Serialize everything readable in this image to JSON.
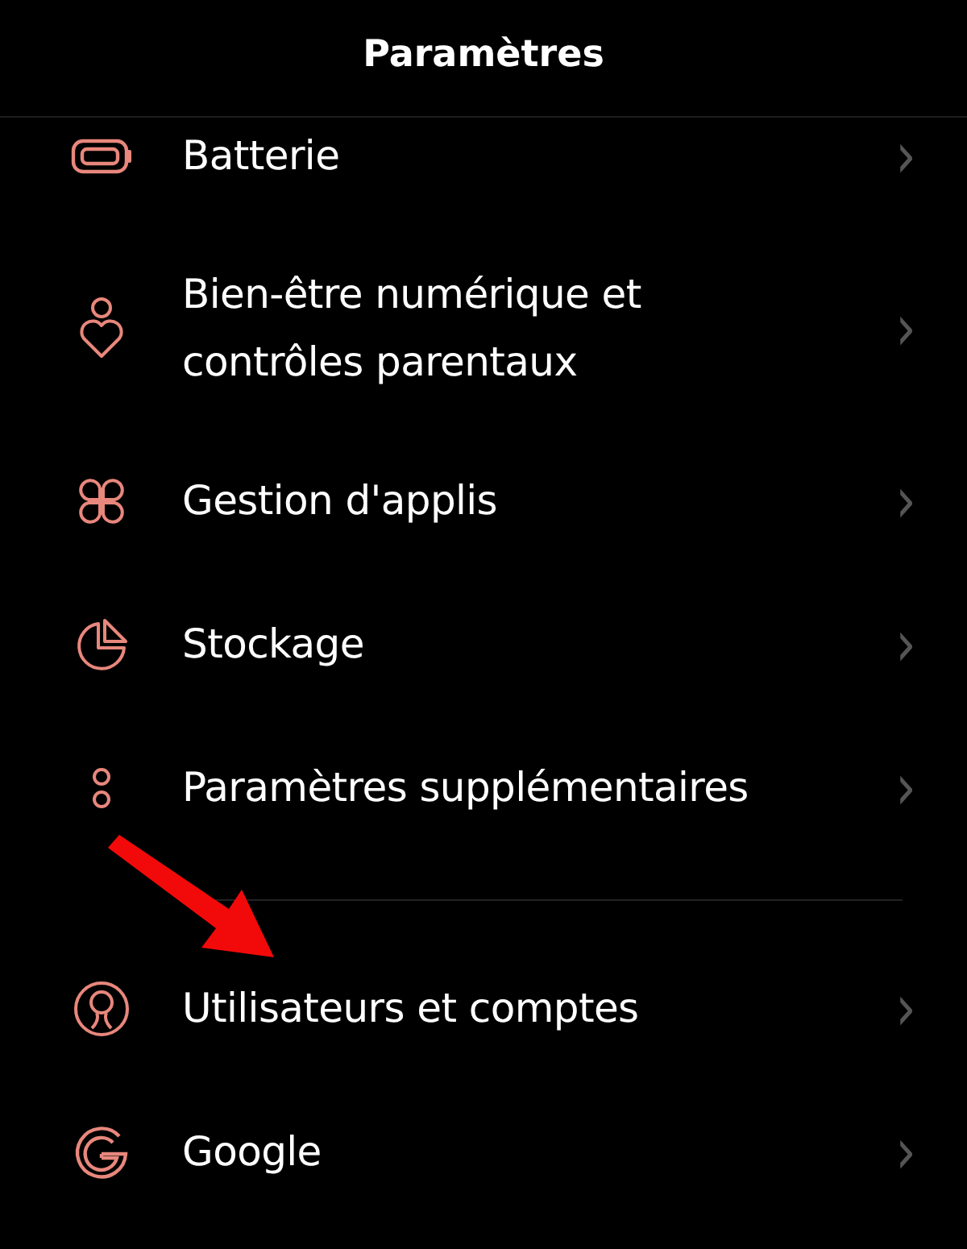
{
  "header": {
    "title": "Paramètres"
  },
  "sections": [
    {
      "items": [
        {
          "kind": "battery",
          "label": "Batterie",
          "chevron": "›"
        },
        {
          "kind": "wellbeing",
          "label": "Bien-être numérique et contrôles parentaux",
          "chevron": "›"
        },
        {
          "kind": "apps",
          "label": "Gestion d'applis",
          "chevron": "›"
        },
        {
          "kind": "storage",
          "label": "Stockage",
          "chevron": "›"
        },
        {
          "kind": "more",
          "label": "Paramètres supplémentaires",
          "chevron": "›"
        }
      ]
    },
    {
      "items": [
        {
          "kind": "users",
          "label": "Utilisateurs et comptes",
          "chevron": "›"
        },
        {
          "kind": "google",
          "label": "Google",
          "chevron": "›"
        }
      ]
    }
  ],
  "annotation": {
    "kind": "arrow"
  }
}
